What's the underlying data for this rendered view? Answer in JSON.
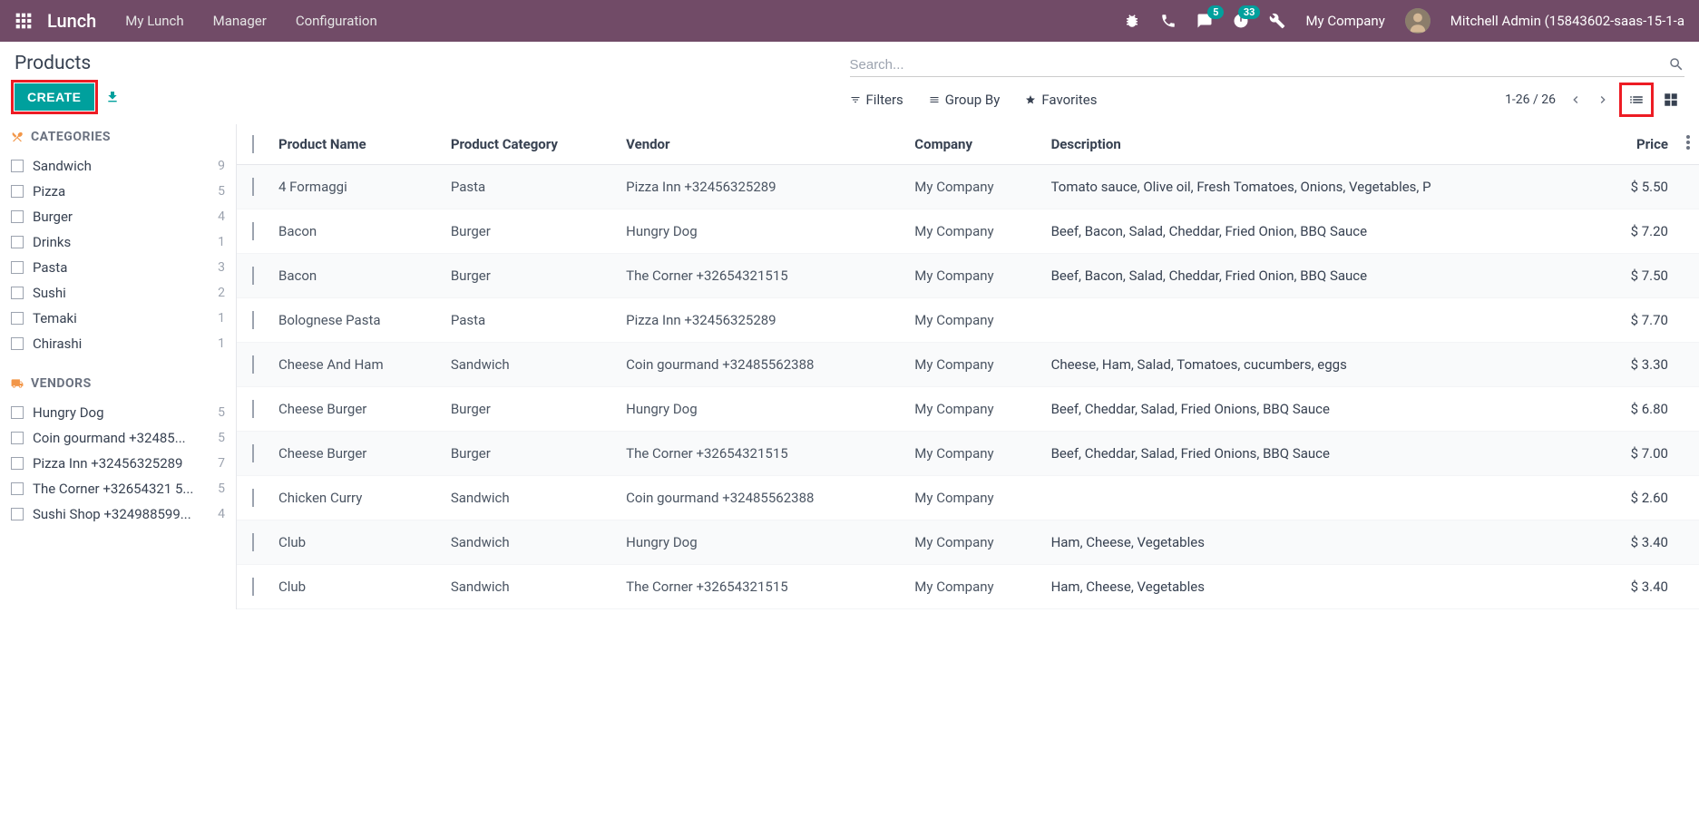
{
  "header": {
    "app_title": "Lunch",
    "menu": [
      "My Lunch",
      "Manager",
      "Configuration"
    ],
    "messages_badge": "5",
    "activities_badge": "33",
    "company": "My Company",
    "user": "Mitchell Admin (15843602-saas-15-1-a"
  },
  "control": {
    "page_title": "Products",
    "create_label": "CREATE",
    "search_placeholder": "Search...",
    "filters_label": "Filters",
    "groupby_label": "Group By",
    "favorites_label": "Favorites",
    "pager": "1-26 / 26"
  },
  "sidebar": {
    "categories_header": "CATEGORIES",
    "vendors_header": "VENDORS",
    "categories": [
      {
        "label": "Sandwich",
        "count": "9"
      },
      {
        "label": "Pizza",
        "count": "5"
      },
      {
        "label": "Burger",
        "count": "4"
      },
      {
        "label": "Drinks",
        "count": "1"
      },
      {
        "label": "Pasta",
        "count": "3"
      },
      {
        "label": "Sushi",
        "count": "2"
      },
      {
        "label": "Temaki",
        "count": "1"
      },
      {
        "label": "Chirashi",
        "count": "1"
      }
    ],
    "vendors": [
      {
        "label": "Hungry Dog",
        "count": "5"
      },
      {
        "label": "Coin gourmand +32485...",
        "count": "5"
      },
      {
        "label": "Pizza Inn +32456325289",
        "count": "7"
      },
      {
        "label": "The Corner +32654321 5...",
        "count": "5"
      },
      {
        "label": "Sushi Shop +324988599...",
        "count": "4"
      }
    ]
  },
  "table": {
    "columns": {
      "name": "Product Name",
      "category": "Product Category",
      "vendor": "Vendor",
      "company": "Company",
      "description": "Description",
      "price": "Price"
    },
    "rows": [
      {
        "name": "4 Formaggi",
        "category": "Pasta",
        "vendor": "Pizza Inn +32456325289",
        "company": "My Company",
        "description": "Tomato sauce, Olive oil, Fresh Tomatoes, Onions, Vegetables, P",
        "price": "$ 5.50"
      },
      {
        "name": "Bacon",
        "category": "Burger",
        "vendor": "Hungry Dog",
        "company": "My Company",
        "description": "Beef, Bacon, Salad, Cheddar, Fried Onion, BBQ Sauce",
        "price": "$ 7.20"
      },
      {
        "name": "Bacon",
        "category": "Burger",
        "vendor": "The Corner +32654321515",
        "company": "My Company",
        "description": "Beef, Bacon, Salad, Cheddar, Fried Onion, BBQ Sauce",
        "price": "$ 7.50"
      },
      {
        "name": "Bolognese Pasta",
        "category": "Pasta",
        "vendor": "Pizza Inn +32456325289",
        "company": "My Company",
        "description": "",
        "price": "$ 7.70"
      },
      {
        "name": "Cheese And Ham",
        "category": "Sandwich",
        "vendor": "Coin gourmand +32485562388",
        "company": "My Company",
        "description": "Cheese, Ham, Salad, Tomatoes, cucumbers, eggs",
        "price": "$ 3.30"
      },
      {
        "name": "Cheese Burger",
        "category": "Burger",
        "vendor": "Hungry Dog",
        "company": "My Company",
        "description": "Beef, Cheddar, Salad, Fried Onions, BBQ Sauce",
        "price": "$ 6.80"
      },
      {
        "name": "Cheese Burger",
        "category": "Burger",
        "vendor": "The Corner +32654321515",
        "company": "My Company",
        "description": "Beef, Cheddar, Salad, Fried Onions, BBQ Sauce",
        "price": "$ 7.00"
      },
      {
        "name": "Chicken Curry",
        "category": "Sandwich",
        "vendor": "Coin gourmand +32485562388",
        "company": "My Company",
        "description": "",
        "price": "$ 2.60"
      },
      {
        "name": "Club",
        "category": "Sandwich",
        "vendor": "Hungry Dog",
        "company": "My Company",
        "description": "Ham, Cheese, Vegetables",
        "price": "$ 3.40"
      },
      {
        "name": "Club",
        "category": "Sandwich",
        "vendor": "The Corner +32654321515",
        "company": "My Company",
        "description": "Ham, Cheese, Vegetables",
        "price": "$ 3.40"
      }
    ]
  }
}
